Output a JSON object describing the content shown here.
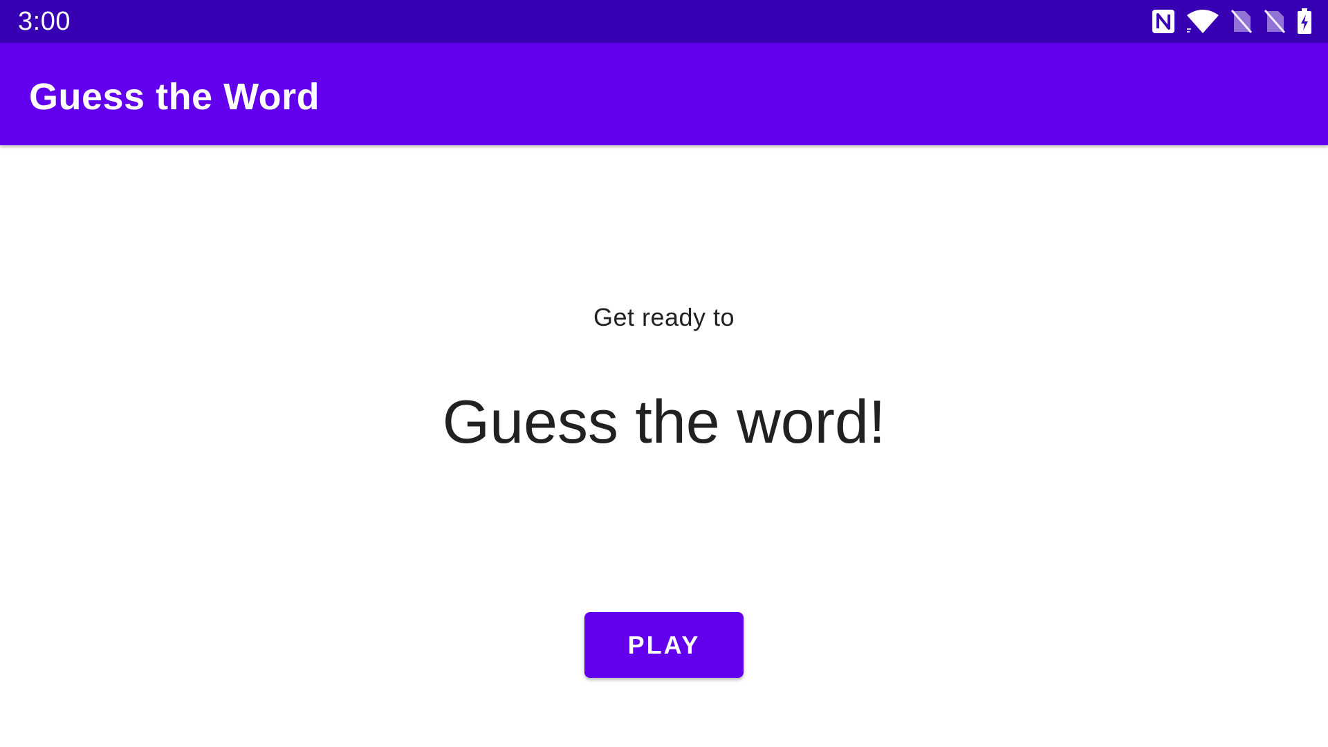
{
  "status_bar": {
    "time": "3:00",
    "icons": [
      "nfc-icon",
      "wifi-icon",
      "no-sim-icon",
      "no-sim-icon",
      "battery-charging-icon"
    ],
    "background": "#3700b3"
  },
  "app_bar": {
    "title": "Guess the Word",
    "background": "#6200ee"
  },
  "main": {
    "subtitle": "Get ready to",
    "headline": "Guess the word!",
    "play_label": "PLAY",
    "accent": "#6200ee"
  }
}
